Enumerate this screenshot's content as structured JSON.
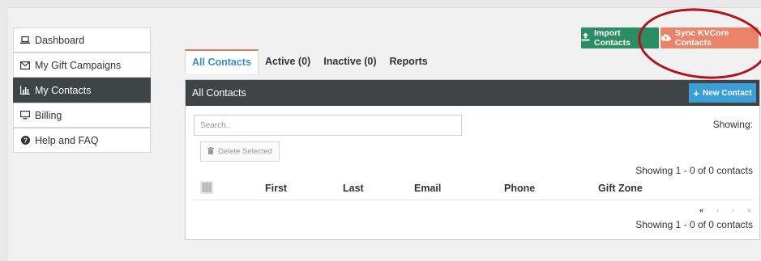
{
  "sidebar": {
    "items": [
      {
        "label": "Dashboard",
        "icon": "laptop-icon",
        "active": false
      },
      {
        "label": "My Gift Campaigns",
        "icon": "envelope-icon",
        "active": false
      },
      {
        "label": "My Contacts",
        "icon": "bar-chart-icon",
        "active": true
      },
      {
        "label": "Billing",
        "icon": "monitor-icon",
        "active": false
      },
      {
        "label": "Help and FAQ",
        "icon": "question-circle-icon",
        "active": false
      }
    ]
  },
  "header": {
    "import_label": "Import Contacts",
    "sync_label": "Sync KVCore Contacts"
  },
  "tabs": [
    {
      "label": "All Contacts",
      "active": true
    },
    {
      "label": "Active (0)",
      "active": false
    },
    {
      "label": "Inactive (0)",
      "active": false
    },
    {
      "label": "Reports",
      "active": false
    }
  ],
  "panel": {
    "title": "All Contacts",
    "new_contact_label": "New Contact",
    "search_placeholder": "Search..",
    "showing_label": "Showing:",
    "delete_label": "Delete Selected",
    "showing_count_top": "Showing 1 - 0 of 0 contacts",
    "showing_count_bottom": "Showing 1 - 0 of 0 contacts",
    "columns": [
      "First",
      "Last",
      "Email",
      "Phone",
      "Gift Zone"
    ],
    "pager": [
      "«",
      "‹",
      "›",
      "»"
    ]
  },
  "colors": {
    "import_button": "#2b8e63",
    "sync_button": "#e8846a",
    "new_contact_button": "#3a9fd6",
    "panel_header": "#3f4446",
    "highlight_circle": "#b3121b"
  }
}
